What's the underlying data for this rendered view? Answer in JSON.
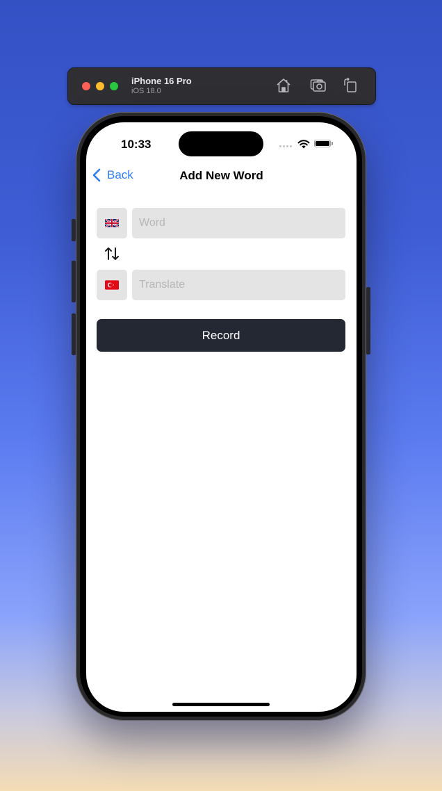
{
  "simulator": {
    "device_name": "iPhone 16 Pro",
    "os_version": "iOS 18.0",
    "toolbar_icons": [
      "home-icon",
      "screenshot-icon",
      "rotate-icon"
    ]
  },
  "status_bar": {
    "time": "10:33"
  },
  "nav": {
    "back_label": "Back",
    "title": "Add New Word"
  },
  "form": {
    "source_language": {
      "flag": "uk-flag-icon",
      "language": "English"
    },
    "target_language": {
      "flag": "turkey-flag-icon",
      "language": "Turkish"
    },
    "word": {
      "value": "",
      "placeholder": "Word"
    },
    "translate": {
      "value": "",
      "placeholder": "Translate"
    },
    "swap_icon": "swap-arrows-icon",
    "record_label": "Record"
  },
  "colors": {
    "accent": "#2f7cf6",
    "record_button": "#232832",
    "field_background": "#e4e4e4"
  }
}
